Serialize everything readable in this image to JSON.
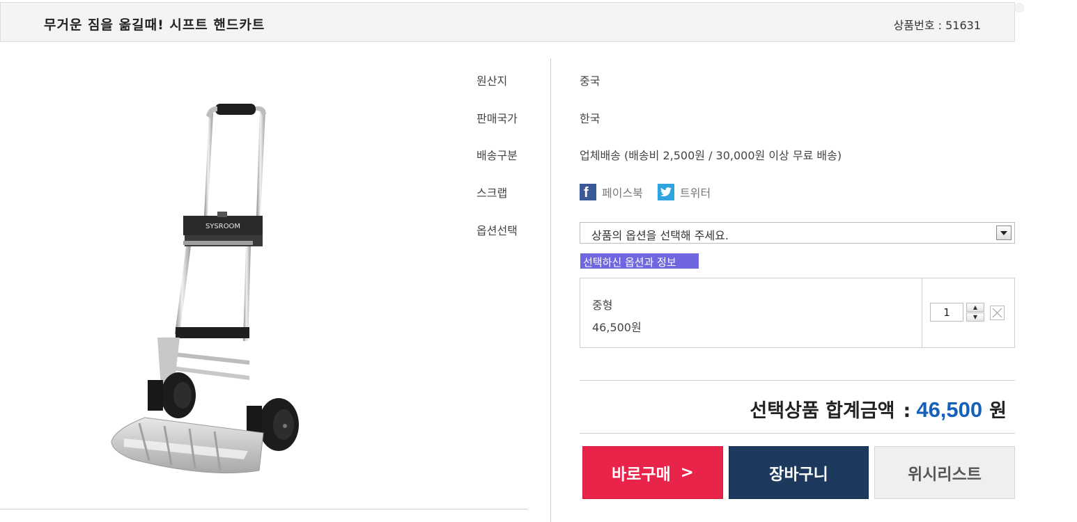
{
  "header": {
    "product_title": "무거운 짐을 옮길때! 시프트 핸드카트",
    "product_number": "상품번호 : 51631"
  },
  "product_image": {
    "brand_text": "SYSROOM"
  },
  "info": {
    "origin_label": "원산지",
    "origin_value": "중국",
    "sales_country_label": "판매국가",
    "sales_country_value": "한국",
    "shipping_label": "배송구분",
    "shipping_value": "업체배송 (배송비 2,500원 / 30,000원 이상 무료 배송)",
    "scrap_label": "스크랩",
    "facebook_label": "페이스북",
    "twitter_label": "트위터",
    "option_label": "옵션선택"
  },
  "option_select": {
    "placeholder": "상품의 옵션을 선택해 주세요."
  },
  "selected_info_badge": "선택하신 옵션과 정보",
  "selected_option": {
    "name": "중형",
    "price": "46,500원",
    "quantity": "1"
  },
  "total": {
    "label": "선택상품 합계금액",
    "colon": ":",
    "amount": "46,500",
    "unit": "원"
  },
  "buttons": {
    "buy_now": "바로구매",
    "buy_now_chevron": ">",
    "cart": "장바구니",
    "wishlist": "위시리스트"
  },
  "colors": {
    "buy_button": "#e8244a",
    "cart_button": "#1d3a5e",
    "wishlist_button": "#efefef",
    "total_amount": "#1560b8",
    "badge": "#7067e0",
    "facebook": "#3b5998",
    "twitter": "#2fa2e0"
  },
  "icons": [
    "facebook-icon",
    "twitter-icon",
    "chevron-down-icon",
    "spin-up-icon",
    "spin-down-icon",
    "close-icon"
  ]
}
